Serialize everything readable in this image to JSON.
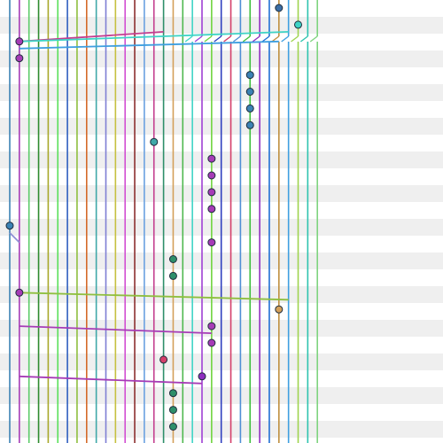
{
  "view": {
    "type": "commit-graph"
  },
  "colors": {
    "row_stripe": "#efefef",
    "background": "#ffffff",
    "commit_stroke": "#1f2d3d"
  },
  "lanes": [
    {
      "id": 0,
      "color": "#3b82b4"
    },
    {
      "id": 1,
      "color": "#a63cb6"
    },
    {
      "id": 2,
      "color": "#5ccc6a"
    },
    {
      "id": 3,
      "color": "#2e8b2e"
    },
    {
      "id": 4,
      "color": "#a8a82a"
    },
    {
      "id": 5,
      "color": "#5ae05a"
    },
    {
      "id": 6,
      "color": "#2f5fbf"
    },
    {
      "id": 7,
      "color": "#8fbf3f"
    },
    {
      "id": 8,
      "color": "#d46a2a"
    },
    {
      "id": 9,
      "color": "#3fa8a8"
    },
    {
      "id": 10,
      "color": "#7f7fd4"
    },
    {
      "id": 11,
      "color": "#c6c040"
    },
    {
      "id": 12,
      "color": "#d24fd2"
    },
    {
      "id": 13,
      "color": "#8b2f2f"
    },
    {
      "id": 14,
      "color": "#6aa0e0"
    },
    {
      "id": 15,
      "color": "#c43f8f"
    },
    {
      "id": 16,
      "color": "#2e8f6a"
    },
    {
      "id": 17,
      "color": "#d4a05a"
    },
    {
      "id": 18,
      "color": "#4fb84f"
    },
    {
      "id": 19,
      "color": "#3fd4c6"
    },
    {
      "id": 20,
      "color": "#9f3fd4"
    },
    {
      "id": 21,
      "color": "#6fd43f"
    },
    {
      "id": 22,
      "color": "#2f3fbf"
    },
    {
      "id": 23,
      "color": "#d43f6a"
    },
    {
      "id": 24,
      "color": "#4f8fd4"
    },
    {
      "id": 25,
      "color": "#3fbf3f"
    },
    {
      "id": 26,
      "color": "#8f2fbf"
    },
    {
      "id": 27,
      "color": "#1f6fd4"
    },
    {
      "id": 28,
      "color": "#bf8f3f"
    },
    {
      "id": 29,
      "color": "#3f9fe0"
    },
    {
      "id": 30,
      "color": "#9fd44f"
    },
    {
      "id": 31,
      "color": "#2fc4b0"
    },
    {
      "id": 32,
      "color": "#7fd47f"
    }
  ],
  "commits": [
    {
      "lane": 28,
      "row": 0,
      "color": "#3b6ea5"
    },
    {
      "lane": 30,
      "row": 1,
      "color": "#3fd4c6"
    },
    {
      "lane": 1,
      "row": 2,
      "color": "#a63cb6"
    },
    {
      "lane": 1,
      "row": 3,
      "color": "#a63cb6"
    },
    {
      "lane": 25,
      "row": 4,
      "color": "#3b82b4"
    },
    {
      "lane": 25,
      "row": 5,
      "color": "#3b82b4"
    },
    {
      "lane": 25,
      "row": 6,
      "color": "#3b82b4"
    },
    {
      "lane": 25,
      "row": 7,
      "color": "#3b82b4"
    },
    {
      "lane": 15,
      "row": 8,
      "color": "#3fa8a8"
    },
    {
      "lane": 21,
      "row": 9,
      "color": "#a63cb6"
    },
    {
      "lane": 21,
      "row": 10,
      "color": "#a63cb6"
    },
    {
      "lane": 21,
      "row": 11,
      "color": "#a63cb6"
    },
    {
      "lane": 21,
      "row": 12,
      "color": "#a63cb6"
    },
    {
      "lane": 0,
      "row": 13,
      "color": "#3b82b4"
    },
    {
      "lane": 21,
      "row": 14,
      "color": "#a63cb6"
    },
    {
      "lane": 17,
      "row": 15,
      "color": "#2e8f6a"
    },
    {
      "lane": 17,
      "row": 16,
      "color": "#2e8f6a"
    },
    {
      "lane": 1,
      "row": 17,
      "color": "#a63cb6"
    },
    {
      "lane": 28,
      "row": 18,
      "color": "#d4a05a"
    },
    {
      "lane": 21,
      "row": 19,
      "color": "#a63cb6"
    },
    {
      "lane": 21,
      "row": 20,
      "color": "#a63cb6"
    },
    {
      "lane": 16,
      "row": 21,
      "color": "#d43f6a"
    },
    {
      "lane": 20,
      "row": 22,
      "color": "#8f2fbf"
    },
    {
      "lane": 17,
      "row": 23,
      "color": "#2e8f6a"
    },
    {
      "lane": 17,
      "row": 24,
      "color": "#2e8f6a"
    },
    {
      "lane": 17,
      "row": 25,
      "color": "#2e8f6a"
    }
  ],
  "edges": [
    {
      "from_lane": 16,
      "to_lane": 1,
      "from_row": 1,
      "to_row": 2,
      "color": "#c43f8f"
    },
    {
      "from_lane": 29,
      "to_lane": 1,
      "from_row": 1,
      "to_row": 2,
      "color": "#3fd4c6"
    },
    {
      "from_lane": 28,
      "to_lane": 1,
      "from_row": 2,
      "to_row": 2,
      "color": "#3f9fe0"
    },
    {
      "from_lane": 1,
      "to_lane": 29,
      "from_row": 17,
      "to_row": 17,
      "color": "#8fbf3f"
    },
    {
      "from_lane": 1,
      "to_lane": 21,
      "from_row": 19,
      "to_row": 19,
      "color": "#a63cb6"
    },
    {
      "from_lane": 1,
      "to_lane": 20,
      "from_row": 22,
      "to_row": 22,
      "color": "#a63cb6"
    },
    {
      "from_lane": 0,
      "to_lane": 1,
      "from_row": 13,
      "to_row": 14,
      "color": "#8f8fd4"
    }
  ]
}
